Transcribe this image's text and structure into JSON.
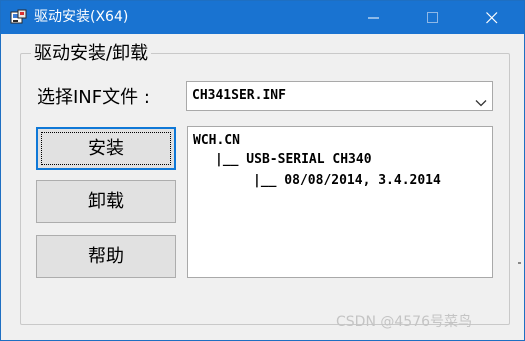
{
  "window": {
    "title": "驱动安装(X64)",
    "titlebar_color": "#1973d1",
    "app_icon": "installer-icon",
    "controls": {
      "minimize_icon": "minimize-icon",
      "maximize_icon": "maximize-icon",
      "close_icon": "close-icon"
    }
  },
  "group": {
    "legend": "驱动安装/卸载"
  },
  "file_select": {
    "label": "选择INF文件 :",
    "value": "CH341SER.INF",
    "dropdown_icon": "chevron-down-icon"
  },
  "buttons": {
    "install": "安装",
    "uninstall": "卸载",
    "help": "帮助"
  },
  "info": {
    "line1": "WCH.CN",
    "line2": "|__ USB-SERIAL CH340",
    "line3": "|__ 08/08/2014, 3.4.2014"
  },
  "watermark": "CSDN @4576号菜鸟"
}
